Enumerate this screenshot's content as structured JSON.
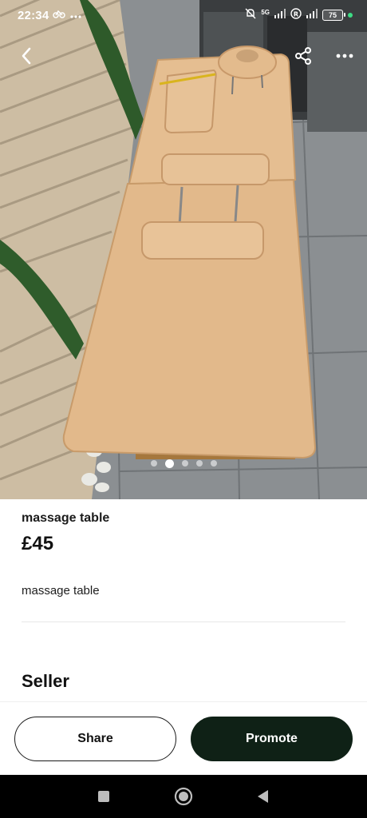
{
  "status_bar": {
    "time": "22:34",
    "network": "5G",
    "battery": "75",
    "icons": [
      "cycle-icon",
      "more-dots-icon",
      "mute-icon",
      "signal-icon",
      "registered-icon",
      "signal-icon",
      "battery-icon"
    ]
  },
  "carousel": {
    "total": 5,
    "active_index": 1
  },
  "listing": {
    "title": "massage table",
    "price": "£45",
    "description": "massage table",
    "seller_heading": "Seller"
  },
  "actions": {
    "share_label": "Share",
    "promote_label": "Promote"
  },
  "colors": {
    "promote_bg": "#0f2116",
    "table_leather": "#e2b98b"
  }
}
